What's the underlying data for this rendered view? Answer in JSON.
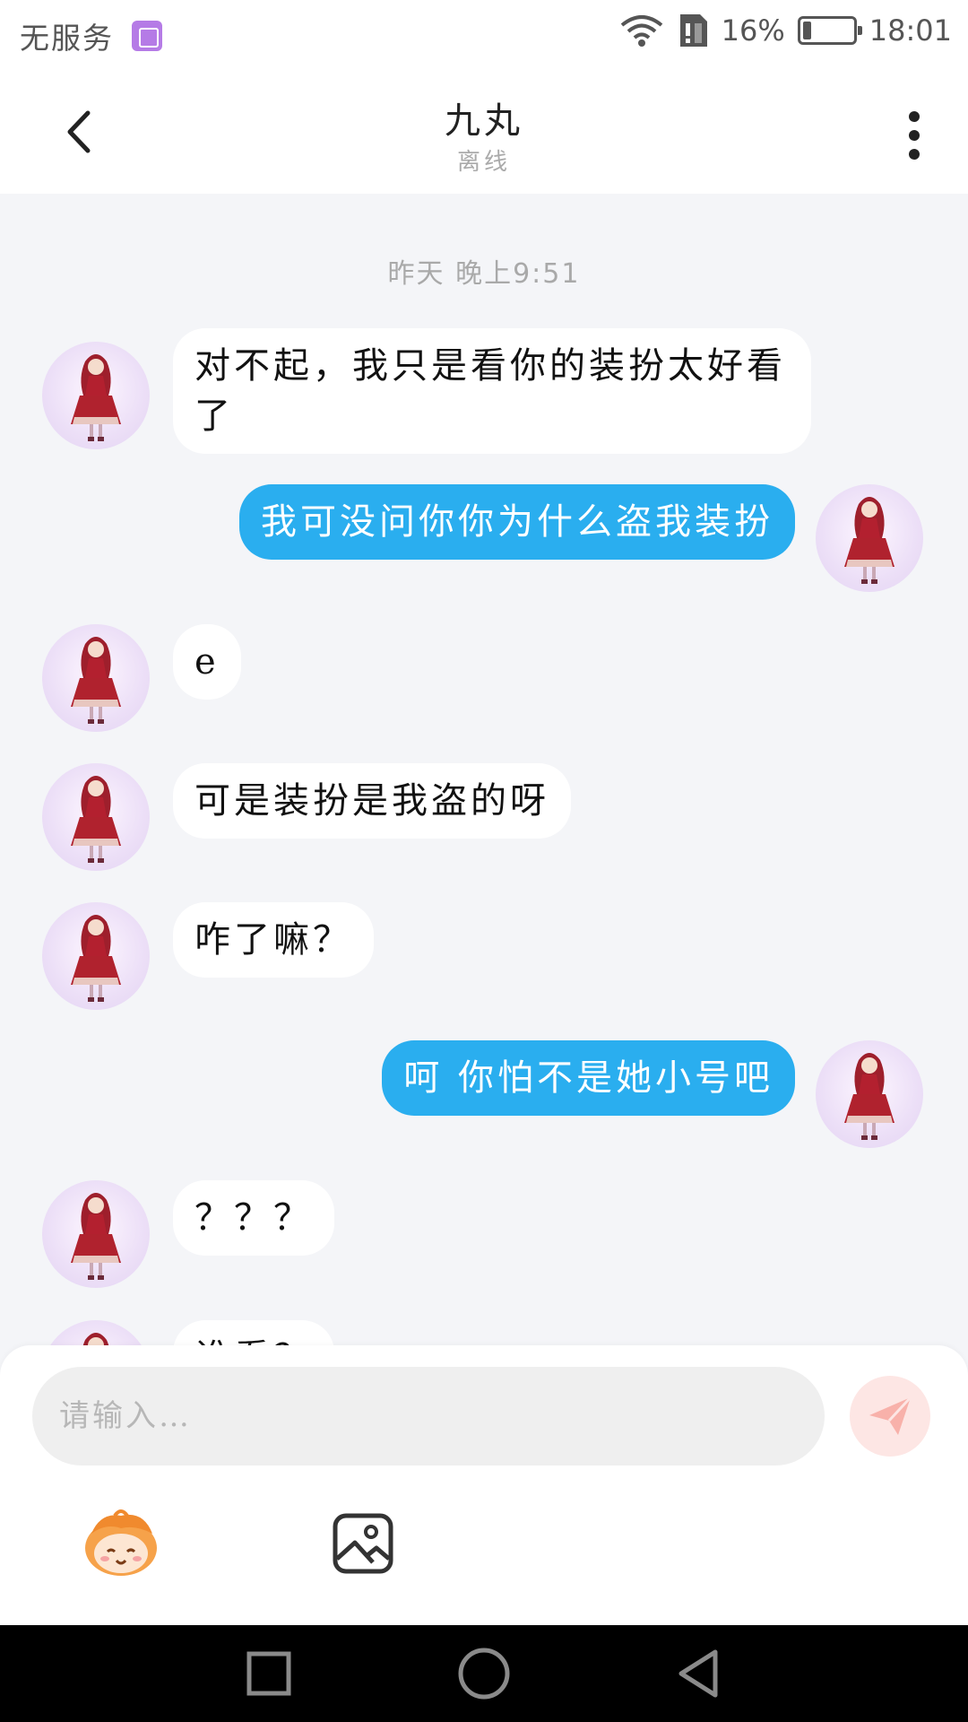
{
  "status_bar": {
    "carrier": "无服务",
    "battery_percent": "16%",
    "battery_level": 0.16,
    "time": "18:01"
  },
  "header": {
    "title": "九丸",
    "status": "离线"
  },
  "chat": {
    "timestamp": "昨天 晚上9:51",
    "messages": [
      {
        "side": "in",
        "text": "对不起，我只是看你的装扮太好看了"
      },
      {
        "side": "out",
        "text": "我可没问你你为什么盗我装扮"
      },
      {
        "side": "in",
        "text": "e"
      },
      {
        "side": "in",
        "text": "可是装扮是我盗的呀"
      },
      {
        "side": "in",
        "text": "咋了嘛？"
      },
      {
        "side": "out",
        "text": "呵 你怕不是她小号吧"
      },
      {
        "side": "in",
        "text": "？？？"
      },
      {
        "side": "in",
        "text": "谁看？"
      }
    ]
  },
  "composer": {
    "placeholder": "请输入…",
    "value": ""
  },
  "icons": {
    "back": "chevron-left-icon",
    "more": "more-vertical-icon",
    "send": "send-icon",
    "emoji": "emoji-face-icon",
    "image": "image-icon",
    "nav_recent": "square-icon",
    "nav_home": "circle-icon",
    "nav_back": "triangle-back-icon"
  },
  "colors": {
    "outgoing_bubble": "#2aaeef",
    "incoming_bubble": "#ffffff",
    "chat_background": "#f4f5f8",
    "send_button": "#fde6e4",
    "send_arrow": "#f8b1aa"
  }
}
